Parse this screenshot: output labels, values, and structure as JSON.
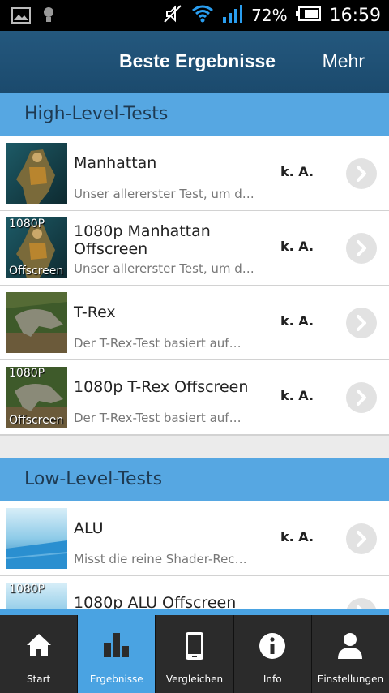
{
  "status_bar": {
    "battery_percent": "72%",
    "clock": "16:59",
    "icons": [
      "picture-icon",
      "bulb-icon",
      "mute-icon",
      "wifi-icon",
      "signal-icon",
      "battery-icon"
    ]
  },
  "action_bar": {
    "title": "Beste Ergebnisse",
    "more_label": "Mehr"
  },
  "sections": [
    {
      "header": "High-Level-Tests",
      "items": [
        {
          "title": "Manhattan",
          "description": "Unser allererster Test, um d…",
          "score": "k. A.",
          "badge_top": "",
          "badge_bottom": ""
        },
        {
          "title": "1080p Manhattan Offscreen",
          "description": "Unser allererster Test, um d…",
          "score": "k. A.",
          "badge_top": "1080P",
          "badge_bottom": "Offscreen"
        },
        {
          "title": "T-Rex",
          "description": "Der T-Rex-Test basiert auf…",
          "score": "k. A.",
          "badge_top": "",
          "badge_bottom": ""
        },
        {
          "title": "1080p T-Rex Offscreen",
          "description": "Der T-Rex-Test basiert auf…",
          "score": "k. A.",
          "badge_top": "1080P",
          "badge_bottom": "Offscreen"
        }
      ]
    },
    {
      "header": "Low-Level-Tests",
      "items": [
        {
          "title": "ALU",
          "description": "Misst die reine Shader-Rec…",
          "score": "k. A.",
          "badge_top": "",
          "badge_bottom": ""
        },
        {
          "title": "1080p ALU Offscreen",
          "description": "",
          "score": "",
          "badge_top": "1080P",
          "badge_bottom": ""
        }
      ]
    }
  ],
  "tabs": [
    {
      "label": "Start",
      "icon": "home-icon",
      "active": false
    },
    {
      "label": "Ergebnisse",
      "icon": "bar-chart-icon",
      "active": true
    },
    {
      "label": "Vergleichen",
      "icon": "phone-icon",
      "active": false
    },
    {
      "label": "Info",
      "icon": "info-icon",
      "active": false
    },
    {
      "label": "Einstellungen",
      "icon": "person-icon",
      "active": false
    }
  ]
}
